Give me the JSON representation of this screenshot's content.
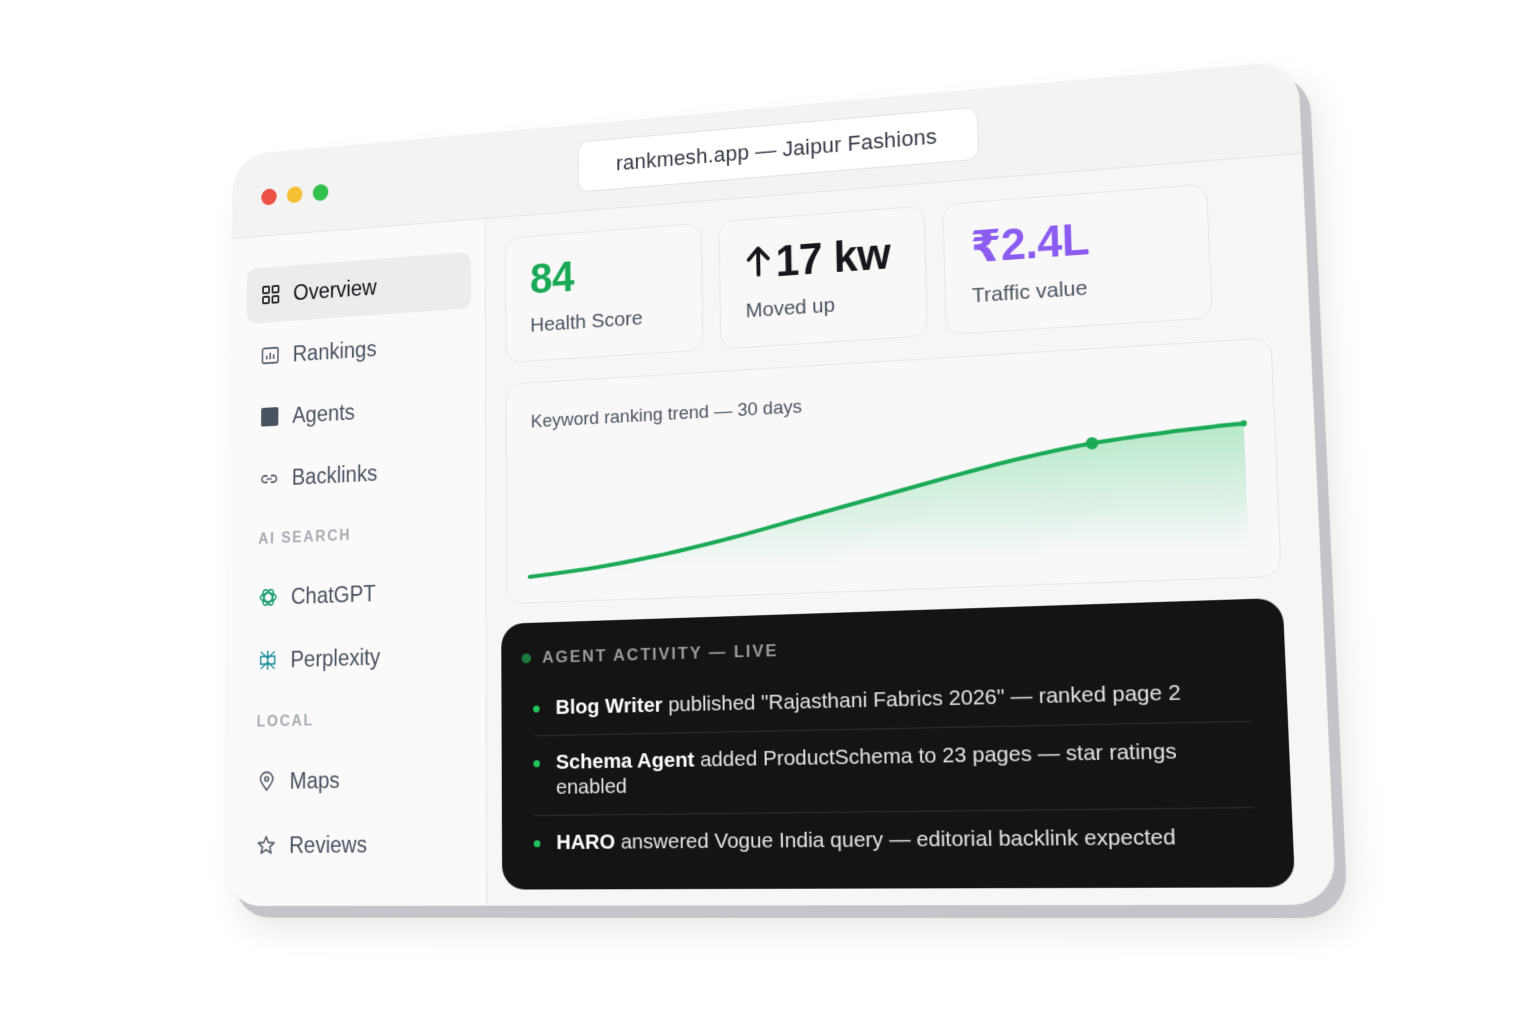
{
  "window": {
    "url_title": "rankmesh.app — Jaipur Fashions"
  },
  "sidebar": {
    "items": [
      {
        "label": "Overview",
        "icon": "grid-icon",
        "active": true
      },
      {
        "label": "Rankings",
        "icon": "bar-chart-icon",
        "active": false
      },
      {
        "label": "Agents",
        "icon": "square-icon",
        "active": false
      },
      {
        "label": "Backlinks",
        "icon": "link-icon",
        "active": false
      }
    ],
    "ai_search": {
      "label": "AI SEARCH",
      "items": [
        {
          "label": "ChatGPT",
          "icon": "chatgpt-icon"
        },
        {
          "label": "Perplexity",
          "icon": "perplexity-icon"
        }
      ]
    },
    "local": {
      "label": "LOCAL",
      "items": [
        {
          "label": "Maps",
          "icon": "map-pin-icon"
        },
        {
          "label": "Reviews",
          "icon": "star-icon"
        }
      ]
    }
  },
  "stats": [
    {
      "value": "84",
      "label": "Health Score",
      "color": "#1aaa55"
    },
    {
      "value": "17 kw",
      "label": "Moved up",
      "color": "#15171b",
      "icon": "arrow-up-icon"
    },
    {
      "value": "₹2.4L",
      "label": "Traffic value",
      "color": "#8c5cf0"
    }
  ],
  "chart": {
    "title": "Keyword ranking trend — 30 days",
    "line_color": "#1aaa55"
  },
  "chart_data": {
    "type": "area",
    "title": "Keyword ranking trend — 30 days",
    "x": [
      0,
      3,
      6,
      9,
      12,
      15,
      18,
      21,
      24,
      27,
      30
    ],
    "values": [
      0,
      1.2,
      3.0,
      5.4,
      8.2,
      11.0,
      13.8,
      16.4,
      18.4,
      19.6,
      20.4
    ],
    "highlight_index": 8,
    "xlabel": "",
    "ylabel": "",
    "grid": false
  },
  "activity": {
    "header": "AGENT ACTIVITY — LIVE",
    "items": [
      {
        "agent": "Blog Writer",
        "text": "published \"Rajasthani Fabrics 2026\" — ranked page 2"
      },
      {
        "agent": "Schema Agent",
        "text": "added ProductSchema to 23 pages — star ratings enabled"
      },
      {
        "agent": "HARO",
        "text": "answered Vogue India query — editorial backlink expected"
      }
    ]
  }
}
